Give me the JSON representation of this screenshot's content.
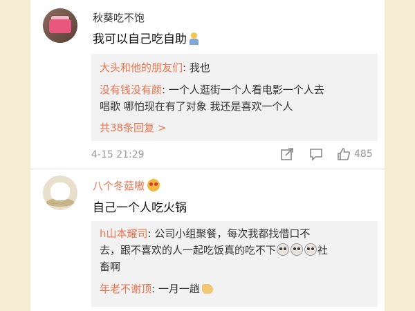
{
  "comments": [
    {
      "username": "秋葵吃不饱",
      "text": "我可以自己吃自助",
      "replies": [
        {
          "name": "大头和他的朋友们",
          "text": "我也"
        },
        {
          "name": "没有钱没有颜",
          "text_line1": "一个人逛街一个人看电影一个人去",
          "text_line2": "唱歌  哪怕现在有了对象  我还是喜欢一个人"
        }
      ],
      "more_replies": "共38条回复 >",
      "timestamp": "4-15 21:29",
      "like_count": "485"
    },
    {
      "username": "八个冬菇嗷",
      "text": "自己一个人吃火锅",
      "replies": [
        {
          "name": "h山本耀司",
          "text_line1": "公司小组聚餐，每次我都找借口不",
          "text_line2": "去，跟不喜欢的人一起吃饭真的吃不下",
          "text_line3_tail": "社",
          "text_line3": "畜啊"
        },
        {
          "name": "年老不谢顶",
          "text": "一月一趟"
        }
      ]
    }
  ],
  "colors": {
    "background": "#f7ecd4",
    "reply_name": "#eb7350",
    "reply_box": "#f2f2f2"
  },
  "icons": [
    "share-icon",
    "comment-icon",
    "like-icon"
  ]
}
